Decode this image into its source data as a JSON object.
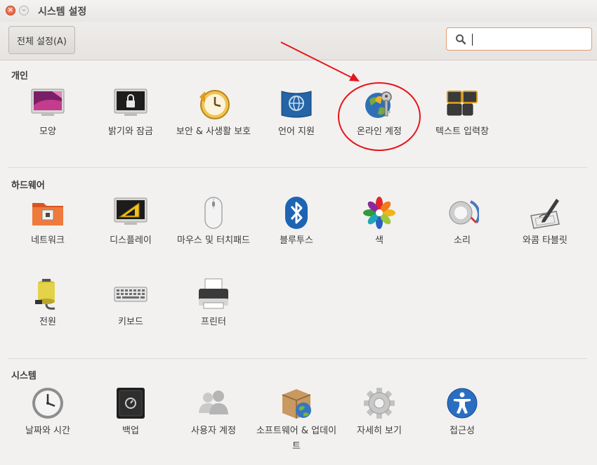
{
  "window": {
    "title": "시스템 설정",
    "close_glyph": "×",
    "min_glyph": "–"
  },
  "toolbar": {
    "all_settings_label": "전체 설정(A)",
    "search_value": "",
    "search_placeholder": ""
  },
  "sections": [
    {
      "title": "개인",
      "items": [
        {
          "label": "모양",
          "icon": "appearance-icon"
        },
        {
          "label": "밝기와 잠금",
          "icon": "brightness-lock-icon"
        },
        {
          "label": "보안 & 사생활 보호",
          "icon": "security-privacy-icon"
        },
        {
          "label": "언어 지원",
          "icon": "language-support-icon"
        },
        {
          "label": "온라인 계정",
          "icon": "online-accounts-icon"
        },
        {
          "label": "텍스트 입력창",
          "icon": "text-entry-icon"
        }
      ]
    },
    {
      "title": "하드웨어",
      "items": [
        {
          "label": "네트워크",
          "icon": "network-icon"
        },
        {
          "label": "디스플레이",
          "icon": "display-icon"
        },
        {
          "label": "마우스 및 터치패드",
          "icon": "mouse-touchpad-icon"
        },
        {
          "label": "블루투스",
          "icon": "bluetooth-icon"
        },
        {
          "label": "색",
          "icon": "color-icon"
        },
        {
          "label": "소리",
          "icon": "sound-icon"
        },
        {
          "label": "와콤 타블릿",
          "icon": "wacom-tablet-icon"
        },
        {
          "label": "전원",
          "icon": "power-icon"
        },
        {
          "label": "키보드",
          "icon": "keyboard-icon"
        },
        {
          "label": "프린터",
          "icon": "printer-icon"
        }
      ]
    },
    {
      "title": "시스템",
      "items": [
        {
          "label": "날짜와 시간",
          "icon": "clock-icon"
        },
        {
          "label": "백업",
          "icon": "backup-safe-icon"
        },
        {
          "label": "사용자 계정",
          "icon": "user-accounts-icon"
        },
        {
          "label": "소프트웨어 & 업데이트",
          "icon": "software-updates-icon"
        },
        {
          "label": "자세히 보기",
          "icon": "details-gear-icon"
        },
        {
          "label": "접근성",
          "icon": "accessibility-icon"
        }
      ]
    }
  ],
  "colors": {
    "accent": "#e4542f",
    "annotation": "#e8141c",
    "search_border": "#e49b73"
  }
}
